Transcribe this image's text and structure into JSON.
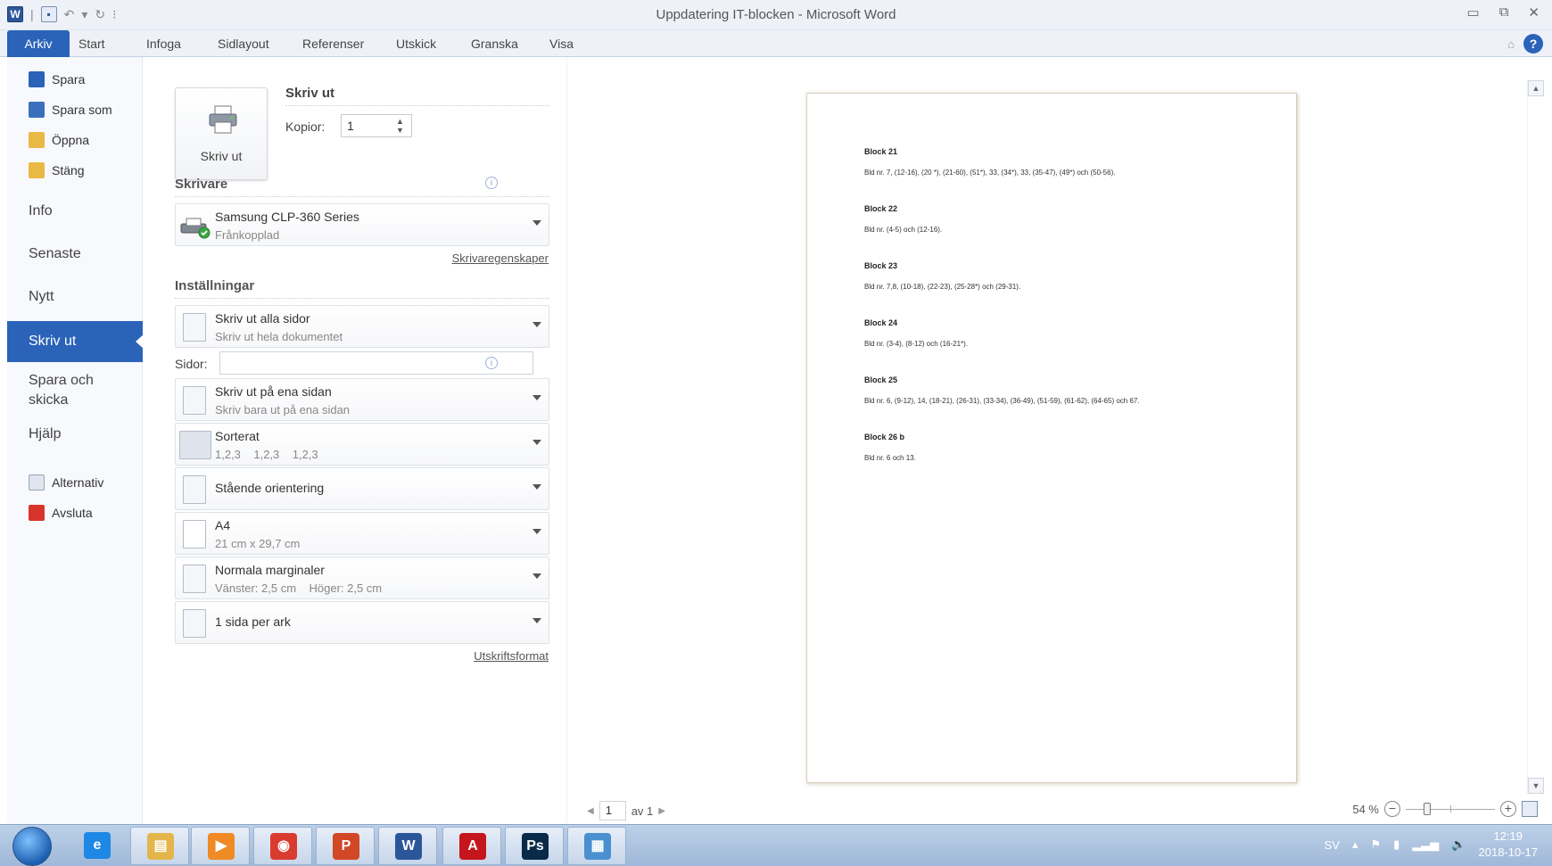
{
  "window": {
    "title": "Uppdatering IT-blocken - Microsoft Word"
  },
  "ribbon": {
    "tabs": [
      "Arkiv",
      "Start",
      "Infoga",
      "Sidlayout",
      "Referenser",
      "Utskick",
      "Granska",
      "Visa"
    ]
  },
  "backstage": {
    "small_items": [
      {
        "label": "Spara",
        "icon": "save-icon",
        "color": "#2a63b8"
      },
      {
        "label": "Spara som",
        "icon": "save-as-icon",
        "color": "#3a6fbe"
      },
      {
        "label": "Öppna",
        "icon": "open-folder-icon",
        "color": "#e9b945"
      },
      {
        "label": "Stäng",
        "icon": "close-folder-icon",
        "color": "#e9b945"
      }
    ],
    "big_items": [
      "Info",
      "Senaste",
      "Nytt"
    ],
    "selected": "Skriv ut",
    "after_items": [
      "Spara och skicka",
      "Hjälp"
    ],
    "bottom_items": [
      {
        "label": "Alternativ",
        "icon": "options-icon",
        "color": "#dfe5ee"
      },
      {
        "label": "Avsluta",
        "icon": "exit-icon",
        "color": "#d9342b"
      }
    ]
  },
  "print": {
    "heading": "Skriv ut",
    "button_label": "Skriv ut",
    "copies_label": "Kopior:",
    "copies_value": "1",
    "printer_section": "Skrivare",
    "printer_name": "Samsung CLP-360 Series",
    "printer_status": "Frånkopplad",
    "printer_props_link": "Skrivaregenskaper",
    "settings_section": "Inställningar",
    "range_main": "Skriv ut alla sidor",
    "range_sub": "Skriv ut hela dokumentet",
    "pages_label": "Sidor:",
    "pages_value": "",
    "sides_main": "Skriv ut på ena sidan",
    "sides_sub": "Skriv bara ut på ena sidan",
    "collate_main": "Sorterat",
    "collate_sub": "1,2,3    1,2,3    1,2,3",
    "orientation": "Stående orientering",
    "paper_main": "A4",
    "paper_sub": "21 cm x 29,7 cm",
    "margins_main": "Normala marginaler",
    "margins_sub": "Vänster: 2,5 cm    Höger: 2,5 cm",
    "per_sheet": "1 sida per ark",
    "page_setup_link": "Utskriftsformat"
  },
  "preview": {
    "blocks": [
      {
        "title": "Block 21",
        "text": "Bld nr. 7, (12-16), (20 *), (21-60), (51*), 33, (34*), 33, (35-47), (49*) och (50-56)."
      },
      {
        "title": "Block 22",
        "text": "Bld nr. (4-5) och (12-16)."
      },
      {
        "title": "Block 23",
        "text": "Bld nr. 7,8, (10-18), (22-23), (25-28*) och (29-31)."
      },
      {
        "title": "Block 24",
        "text": "Bld nr. (3-4), (8-12) och (16-21*)."
      },
      {
        "title": "Block 25",
        "text": "Bld nr. 6, (9-12), 14, (18-21), (26-31), (33-34), (36-49), (51-59), (61-62), (64-65) och 67."
      },
      {
        "title": "Block 26 b",
        "text": "Bld nr. 6 och 13."
      }
    ],
    "page_current": "1",
    "page_total_label": "av 1",
    "zoom_label": "54 %",
    "zoom_level": 0.54
  },
  "taskbar": {
    "apps": [
      {
        "name": "internet-explorer",
        "glyph": "e",
        "color": "#1e88e5"
      },
      {
        "name": "file-explorer",
        "glyph": "▤",
        "color": "#e4b54b"
      },
      {
        "name": "media-player",
        "glyph": "▶",
        "color": "#f08a24"
      },
      {
        "name": "chrome",
        "glyph": "◉",
        "color": "#d93c2f"
      },
      {
        "name": "powerpoint",
        "glyph": "P",
        "color": "#d24726"
      },
      {
        "name": "word",
        "glyph": "W",
        "color": "#2b579a"
      },
      {
        "name": "acrobat",
        "glyph": "A",
        "color": "#c4161c"
      },
      {
        "name": "photoshop",
        "glyph": "Ps",
        "color": "#0a2a4a"
      },
      {
        "name": "remote-desktop",
        "glyph": "▦",
        "color": "#4a8fd0"
      }
    ],
    "language": "SV",
    "time": "12:19",
    "date": "2018-10-17"
  }
}
